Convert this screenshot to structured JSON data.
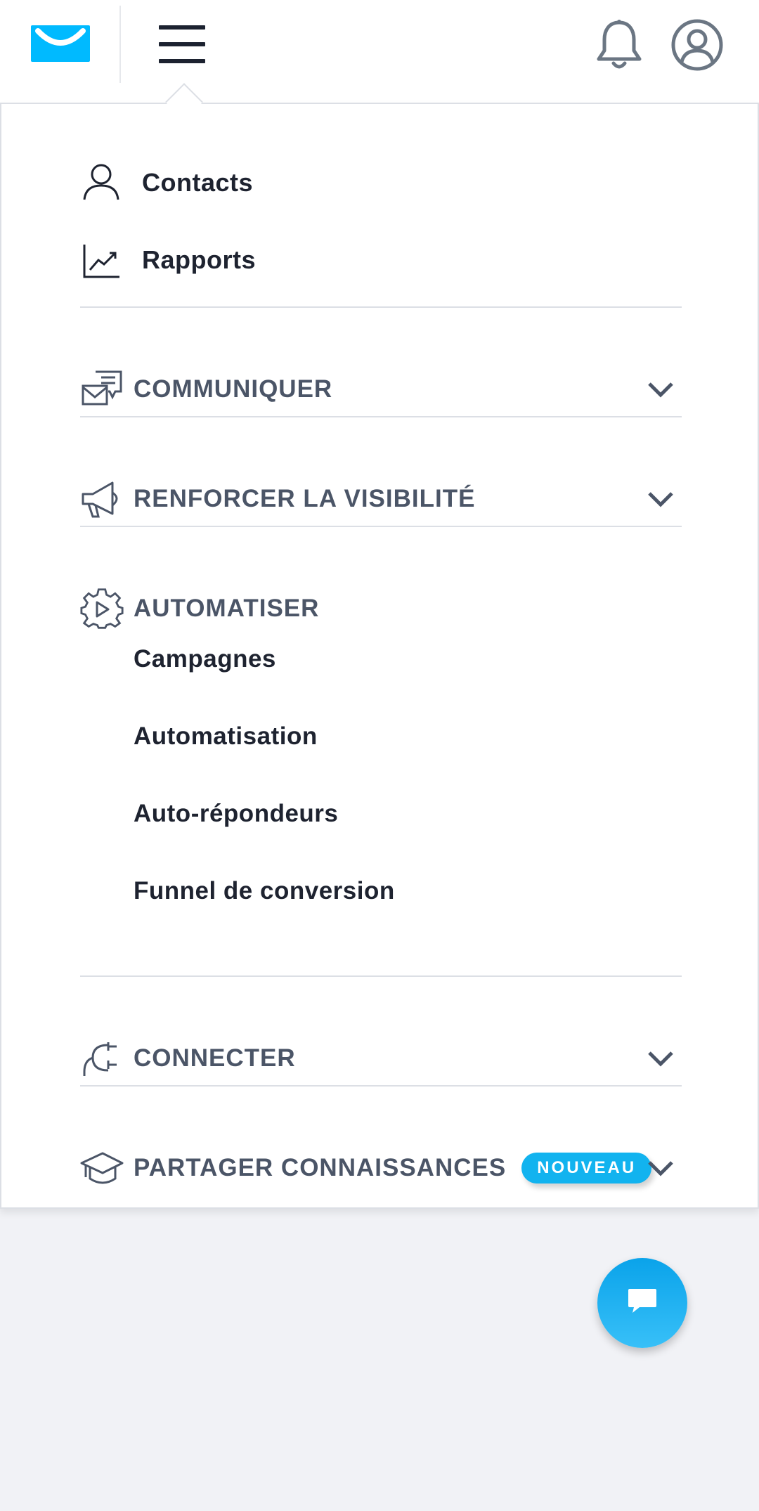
{
  "header": {
    "logo_icon": "envelope-smile-logo",
    "menu_icon": "hamburger-icon",
    "notifications_icon": "bell-icon",
    "account_icon": "user-circle-icon"
  },
  "menu": {
    "top_items": [
      {
        "label": "Contacts",
        "icon": "user-icon"
      },
      {
        "label": "Rapports",
        "icon": "chart-line-icon"
      }
    ],
    "sections": [
      {
        "label": "COMMUNIQUER",
        "icon": "mail-chat-icon",
        "expanded": false
      },
      {
        "label": "RENFORCER LA VISIBILITÉ",
        "icon": "megaphone-icon",
        "expanded": false
      },
      {
        "label": "AUTOMATISER",
        "icon": "gear-play-icon",
        "expanded": true,
        "items": [
          "Campagnes",
          "Automatisation",
          "Auto-répondeurs",
          "Funnel de conversion"
        ]
      },
      {
        "label": "CONNECTER",
        "icon": "plug-icon",
        "expanded": false
      },
      {
        "label": "PARTAGER CONNAISSANCES",
        "icon": "graduation-cap-icon",
        "expanded": false,
        "badge": "NOUVEAU"
      }
    ]
  },
  "chat_button": {
    "icon": "chat-bubble-icon"
  },
  "colors": {
    "brand_blue": "#00baff",
    "badge_blue": "#12b3ef",
    "section_text": "#4b5567",
    "item_text": "#1e2330",
    "background": "#f1f2f6"
  }
}
